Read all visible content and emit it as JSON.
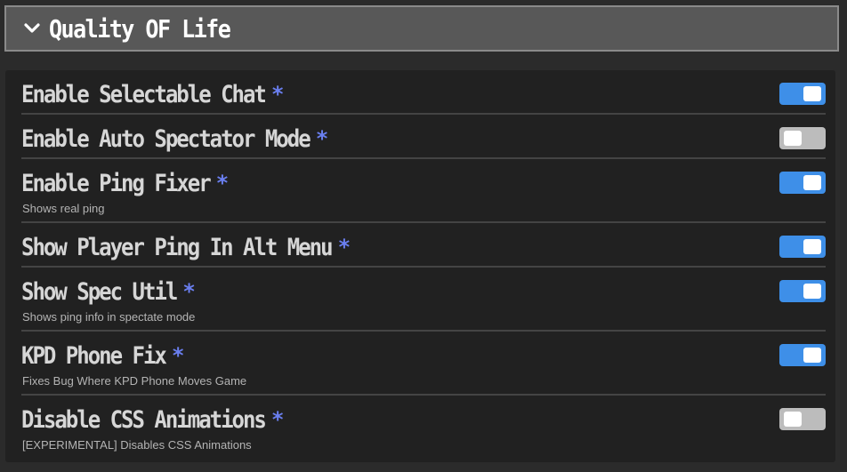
{
  "section": {
    "title": "Quality OF Life",
    "expanded": true,
    "chevron_icon": "chevron-down-icon"
  },
  "colors": {
    "header_bg": "#585858",
    "header_border": "#8a8a8a",
    "panel_bg": "#212121",
    "page_bg": "#2b2b2b",
    "asterisk": "#6a7ff0",
    "toggle_on": "#3e8fe8",
    "toggle_off": "#bcbcbc"
  },
  "settings": [
    {
      "label": "Enable Selectable Chat",
      "marker": "*",
      "description": "",
      "enabled": true
    },
    {
      "label": "Enable Auto Spectator Mode",
      "marker": "*",
      "description": "",
      "enabled": false
    },
    {
      "label": "Enable Ping Fixer",
      "marker": "*",
      "description": "Shows real ping",
      "enabled": true
    },
    {
      "label": "Show Player Ping In Alt Menu",
      "marker": "*",
      "description": "",
      "enabled": true
    },
    {
      "label": "Show Spec Util",
      "marker": "*",
      "description": "Shows ping info in spectate mode",
      "enabled": true
    },
    {
      "label": "KPD Phone Fix",
      "marker": "*",
      "description": "Fixes Bug Where KPD Phone Moves Game",
      "enabled": true
    },
    {
      "label": "Disable CSS Animations",
      "marker": "*",
      "description": "[EXPERIMENTAL] Disables CSS Animations",
      "enabled": false
    }
  ]
}
